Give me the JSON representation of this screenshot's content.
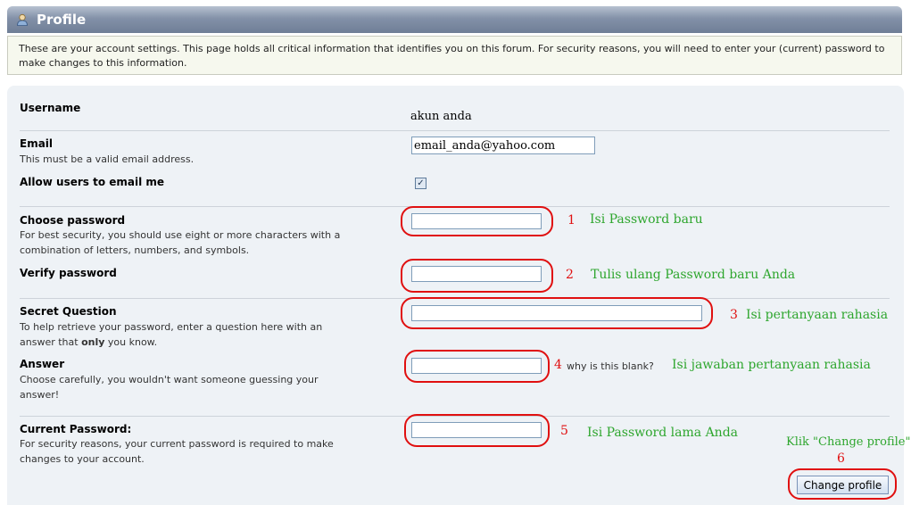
{
  "header": {
    "title": "Profile",
    "icon": "user-icon"
  },
  "intro_text": "These are your account settings. This page holds all critical information that identifies you on this forum. For security reasons, you will need to enter your (current) password to make changes to this information.",
  "fields": {
    "username": {
      "label": "Username",
      "value": "akun anda"
    },
    "email": {
      "label": "Email",
      "desc": "This must be a valid email address.",
      "value": "email_anda@yahoo.com"
    },
    "allow_email": {
      "label": "Allow users to email me",
      "checked": true
    },
    "choose_password": {
      "label": "Choose password",
      "desc": "For best security, you should use eight or more characters with a combination of letters, numbers, and symbols."
    },
    "verify_password": {
      "label": "Verify password"
    },
    "secret_question": {
      "label": "Secret Question",
      "desc_before": "To help retrieve your password, enter a question here with an answer that ",
      "desc_bold": "only",
      "desc_after": " you know."
    },
    "answer": {
      "label": "Answer",
      "desc": "Choose carefully, you wouldn't want someone guessing your answer!",
      "why_link": "why is this blank?"
    },
    "current_password": {
      "label": "Current Password:",
      "desc": "For security reasons, your current password is required to make changes to your account."
    }
  },
  "submit_label": "Change profile",
  "annotations": {
    "n1": "1",
    "t1": "Isi Password baru",
    "n2": "2",
    "t2": "Tulis ulang Password baru Anda",
    "n3": "3",
    "t3": "Isi pertanyaan rahasia",
    "n4": "4",
    "t4": "Isi jawaban pertanyaan rahasia",
    "n5": "5",
    "t5": "Isi Password lama Anda",
    "n6": "6",
    "t6": "Klik \"Change profile\""
  },
  "colors": {
    "annotation_number": "#e01010",
    "annotation_text": "#2ea62e",
    "header_bg": "#7f8da4"
  }
}
